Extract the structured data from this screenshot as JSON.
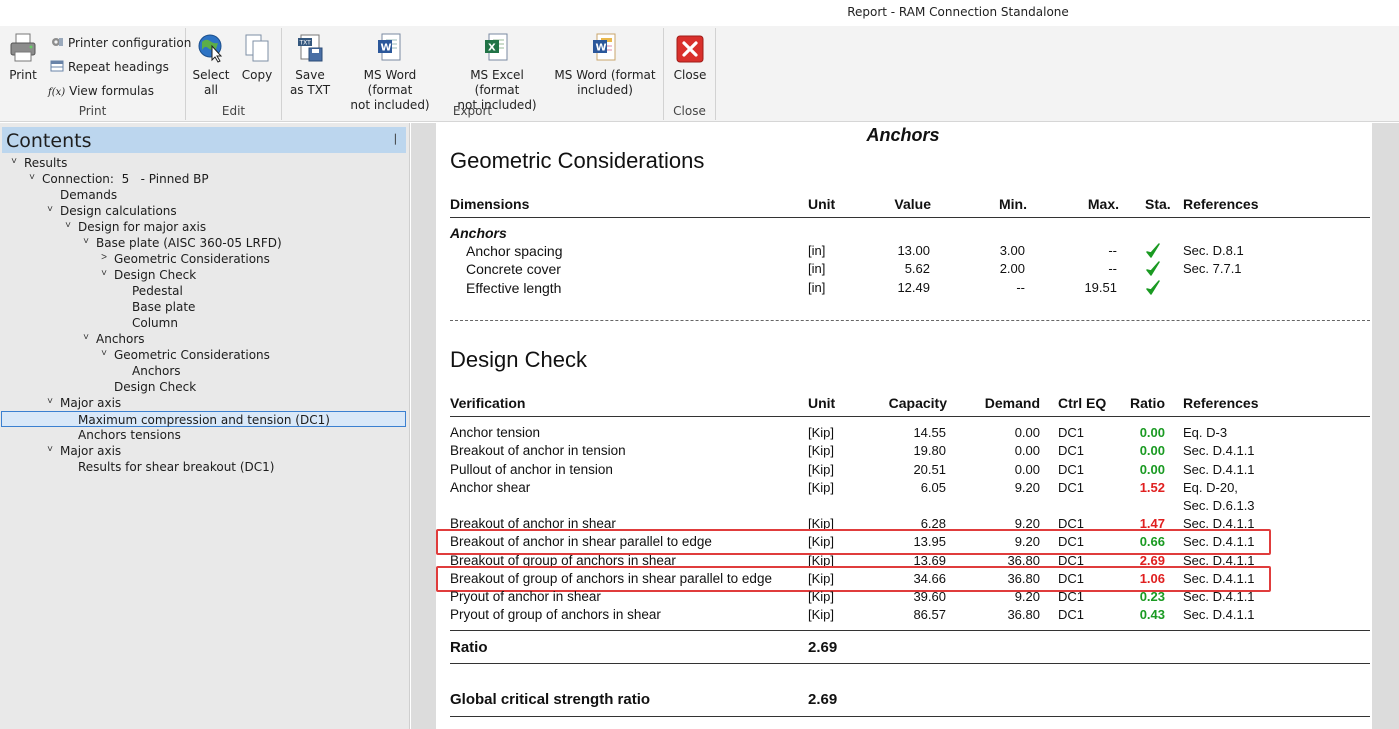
{
  "window": {
    "title": "Report - RAM Connection Standalone"
  },
  "ribbon": {
    "print": {
      "print_label": "Print",
      "printer_config": "Printer configuration",
      "repeat_headings": "Repeat headings",
      "view_formulas": "View formulas",
      "fx": "f(x)",
      "group_label": "Print"
    },
    "edit": {
      "select_all_l1": "Select",
      "select_all_l2": "all",
      "copy": "Copy",
      "group_label": "Edit"
    },
    "export": {
      "save_txt_l1": "Save",
      "save_txt_l2": "as TXT",
      "word1_l1": "MS Word (format",
      "word1_l2": "not included)",
      "excel_l1": "MS Excel  (format",
      "excel_l2": "not included)",
      "word2_l1": "MS Word (format",
      "word2_l2": "included)",
      "group_label": "Export"
    },
    "close": {
      "close_label": "Close",
      "group_label": "Close"
    },
    "colors": {
      "accent_blue": "#2b579a",
      "excel_green": "#217346",
      "close_red": "#d9302c"
    }
  },
  "contents": {
    "title": "Contents",
    "pin": "❘",
    "nodes": [
      {
        "label": "Results",
        "toggle": "˅"
      },
      {
        "label": "Connection:  5   - Pinned BP",
        "toggle": "˅"
      },
      {
        "label": "Demands",
        "toggle": ""
      },
      {
        "label": "Design calculations",
        "toggle": "˅"
      },
      {
        "label": "Design for major axis",
        "toggle": "˅"
      },
      {
        "label": "Base plate (AISC 360-05 LRFD)",
        "toggle": "˅"
      },
      {
        "label": "Geometric Considerations",
        "toggle": ">"
      },
      {
        "label": "Design Check",
        "toggle": "˅"
      },
      {
        "label": "Pedestal",
        "toggle": ""
      },
      {
        "label": "Base plate",
        "toggle": ""
      },
      {
        "label": "Column",
        "toggle": ""
      },
      {
        "label": "Anchors",
        "toggle": "˅"
      },
      {
        "label": "Geometric Considerations",
        "toggle": "˅"
      },
      {
        "label": "Anchors",
        "toggle": ""
      },
      {
        "label": "Design Check",
        "toggle": ""
      },
      {
        "label": "Major axis",
        "toggle": "˅"
      },
      {
        "label": "Maximum compression and tension (DC1)",
        "toggle": ""
      },
      {
        "label": "Anchors tensions",
        "toggle": ""
      },
      {
        "label": "Major axis",
        "toggle": "˅"
      },
      {
        "label": "Results for shear breakout (DC1)",
        "toggle": ""
      }
    ]
  },
  "report": {
    "section_title": "Anchors",
    "geometric": {
      "heading": "Geometric Considerations",
      "columns": {
        "dimensions": "Dimensions",
        "unit": "Unit",
        "value": "Value",
        "min": "Min.",
        "max": "Max.",
        "sta": "Sta.",
        "references": "References"
      },
      "group_label": "Anchors",
      "rows": [
        {
          "name": "Anchor spacing",
          "unit": "[in]",
          "value": "13.00",
          "min": "3.00",
          "max": "--",
          "sta": "ok",
          "ref": "Sec. D.8.1"
        },
        {
          "name": "Concrete cover",
          "unit": "[in]",
          "value": "5.62",
          "min": "2.00",
          "max": "--",
          "sta": "ok",
          "ref": "Sec. 7.7.1"
        },
        {
          "name": "Effective length",
          "unit": "[in]",
          "value": "12.49",
          "min": "--",
          "max": "19.51",
          "sta": "ok",
          "ref": ""
        }
      ]
    },
    "design_check": {
      "heading": "Design Check",
      "columns": {
        "verification": "Verification",
        "unit": "Unit",
        "capacity": "Capacity",
        "demand": "Demand",
        "ctrl_eq": "Ctrl EQ",
        "ratio": "Ratio",
        "references": "References"
      },
      "rows": [
        {
          "name": "Anchor tension",
          "unit": "[Kip]",
          "capacity": "14.55",
          "demand": "0.00",
          "ctrl": "DC1",
          "ratio": "0.00",
          "status": "ok",
          "ref": "Eq. D-3",
          "ref2": ""
        },
        {
          "name": "Breakout of anchor in tension",
          "unit": "[Kip]",
          "capacity": "19.80",
          "demand": "0.00",
          "ctrl": "DC1",
          "ratio": "0.00",
          "status": "ok",
          "ref": "Sec. D.4.1.1",
          "ref2": ""
        },
        {
          "name": "Pullout of anchor in tension",
          "unit": "[Kip]",
          "capacity": "20.51",
          "demand": "0.00",
          "ctrl": "DC1",
          "ratio": "0.00",
          "status": "ok",
          "ref": "Sec. D.4.1.1",
          "ref2": ""
        },
        {
          "name": "Anchor shear",
          "unit": "[Kip]",
          "capacity": "6.05",
          "demand": "9.20",
          "ctrl": "DC1",
          "ratio": "1.52",
          "status": "fail",
          "ref": "Eq. D-20,",
          "ref2": "Sec. D.6.1.3"
        },
        {
          "name": "Breakout of anchor in shear",
          "unit": "[Kip]",
          "capacity": "6.28",
          "demand": "9.20",
          "ctrl": "DC1",
          "ratio": "1.47",
          "status": "fail",
          "ref": "Sec. D.4.1.1",
          "ref2": ""
        },
        {
          "name": "Breakout of anchor in shear parallel to edge",
          "unit": "[Kip]",
          "capacity": "13.95",
          "demand": "9.20",
          "ctrl": "DC1",
          "ratio": "0.66",
          "status": "ok",
          "ref": "Sec. D.4.1.1",
          "ref2": "",
          "highlighted": true
        },
        {
          "name": "Breakout of group of anchors in shear",
          "unit": "[Kip]",
          "capacity": "13.69",
          "demand": "36.80",
          "ctrl": "DC1",
          "ratio": "2.69",
          "status": "fail",
          "ref": "Sec. D.4.1.1",
          "ref2": ""
        },
        {
          "name": "Breakout of group of anchors in shear parallel to edge",
          "unit": "[Kip]",
          "capacity": "34.66",
          "demand": "36.80",
          "ctrl": "DC1",
          "ratio": "1.06",
          "status": "fail",
          "ref": "Sec. D.4.1.1",
          "ref2": "",
          "highlighted": true
        },
        {
          "name": "Pryout of anchor in shear",
          "unit": "[Kip]",
          "capacity": "39.60",
          "demand": "9.20",
          "ctrl": "DC1",
          "ratio": "0.23",
          "status": "ok",
          "ref": "Sec. D.4.1.1",
          "ref2": ""
        },
        {
          "name": "Pryout of group of anchors in shear",
          "unit": "[Kip]",
          "capacity": "86.57",
          "demand": "36.80",
          "ctrl": "DC1",
          "ratio": "0.43",
          "status": "ok",
          "ref": "Sec. D.4.1.1",
          "ref2": ""
        }
      ],
      "ratio_label": "Ratio",
      "ratio_value": "2.69"
    },
    "global": {
      "label": "Global critical strength ratio",
      "value": "2.69"
    },
    "colors": {
      "ok": "#1a9a22",
      "fail": "#e02020",
      "highlight": "#e03c3c"
    }
  }
}
